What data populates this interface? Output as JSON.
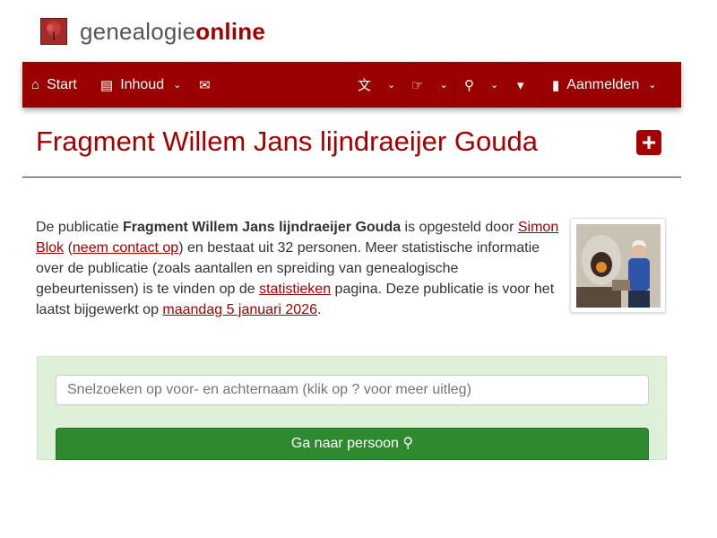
{
  "brand": {
    "part1": "genealogie",
    "part2": "online"
  },
  "nav": {
    "start": {
      "icon": "home-icon",
      "label": "Start"
    },
    "inhoud": {
      "icon": "book-icon",
      "label": "Inhoud"
    },
    "chat": {
      "icon": "comments-icon"
    },
    "language": {
      "icon": "translate-icon"
    },
    "share": {
      "icon": "hand-point-right-icon"
    },
    "search": {
      "icon": "search-icon"
    },
    "cart": {
      "icon": "cart-icon"
    },
    "login": {
      "icon": "lock-icon",
      "label": "Aanmelden"
    }
  },
  "page": {
    "title": "Fragment Willem Jans lijndraeijer Gouda",
    "plus_icon": "plus-square-icon"
  },
  "description": {
    "t1": "De publicatie ",
    "pub_name": "Fragment Willem Jans lijndraeijer Gouda",
    "t2": " is opgesteld door ",
    "author": "Simon Blok",
    "t3": " (",
    "contact": "neem contact op",
    "t4": ") en bestaat uit 32 personen. Meer statistische informatie over de publicatie (zoals aantallen en spreiding van genealogische gebeurtenissen) is te vinden op de ",
    "stats": "statistieken",
    "t5": " pagina. Deze publicatie is voor het laatst bijgewerkt op ",
    "date": "maandag 5 januari 2026",
    "t6": "."
  },
  "search": {
    "placeholder": "Snelzoeken op voor- en achternaam (klik op ? voor meer uitleg)",
    "button_label": "Ga naar persoon"
  },
  "colors": {
    "brand": "#9b0000",
    "panel": "#dff0d8",
    "button": "#2f8a2f"
  }
}
